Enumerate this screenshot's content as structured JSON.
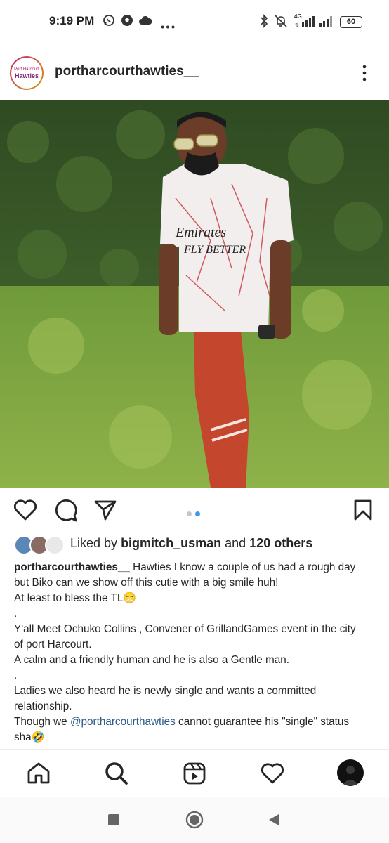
{
  "status_bar": {
    "time": "9:19 PM",
    "left_icons": [
      "whatsapp-icon",
      "soccer-ball-icon",
      "cloud-icon",
      "more-dots-icon"
    ],
    "right_icons": [
      "bluetooth-icon",
      "mute-icon",
      "signal-4g-icon",
      "signal-icon"
    ],
    "network": "4G",
    "battery": "60"
  },
  "post": {
    "logo_top": "Port Harcourt",
    "logo_bottom": "Hawties",
    "username": "portharcourthawties__",
    "carousel": {
      "count": 2,
      "active": 1
    },
    "likes": {
      "prefix": "Liked by",
      "user": "bigmitch_usman",
      "middle": "and",
      "others": "120 others"
    },
    "caption": {
      "username": "portharcourthawties__",
      "line1": " Hawties I know a couple of us had a rough day",
      "line2": "but Biko can we show off this cutie with a big smile huh!",
      "line3": "At least to bless the TL😁",
      "line4": ".",
      "line5": "Y'all Meet Ochuko Collins , Convener of GrillandGames event in the city",
      "line6": "of port Harcourt.",
      "line7": "A calm and a friendly human and he is also a Gentle man.",
      "line8": ".",
      "line9": "Ladies we also heard he is newly single and wants a committed",
      "line10": "relationship.",
      "line11_prefix": "Though we ",
      "line11_mention": "@portharcourthawties",
      "line11_suffix": " cannot guarantee his \"single\" status",
      "line12": "sha🤣"
    }
  },
  "bottom_nav": [
    "home-icon",
    "search-icon",
    "reels-icon",
    "activity-heart-icon",
    "profile-avatar"
  ],
  "system_nav": [
    "recents-square-icon",
    "home-circle-icon",
    "back-triangle-icon"
  ],
  "colors": {
    "mention": "#2b5a88",
    "carousel_active": "#3897f0",
    "carousel_inactive": "#c7c7c7"
  }
}
